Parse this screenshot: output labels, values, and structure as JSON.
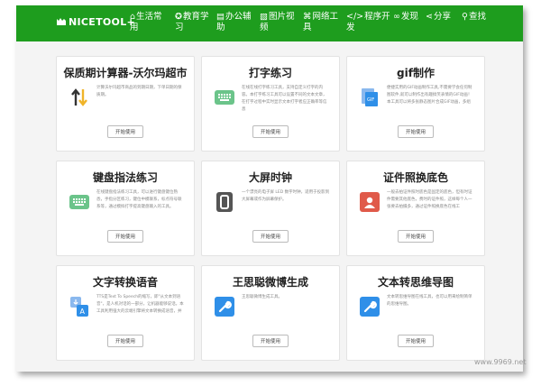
{
  "nav": {
    "logo": "NICETOOL+",
    "items": [
      {
        "icon": "⌂",
        "label": "生活常用"
      },
      {
        "icon": "✪",
        "label": "教育学习"
      },
      {
        "icon": "▤",
        "label": "办公辅助"
      },
      {
        "icon": "▧",
        "label": "图片视频"
      },
      {
        "icon": "⌘",
        "label": "网络工具"
      },
      {
        "icon": "</>",
        "label": "程序开发"
      },
      {
        "icon": "∞",
        "label": "发现"
      },
      {
        "icon": "⋖",
        "label": "分享"
      },
      {
        "icon": "⚲",
        "label": "查找"
      }
    ]
  },
  "colors": {
    "nav_bg": "#1e9d1e",
    "accent": "#2f8fe8",
    "keyboard_green": "#6bc48a",
    "profile_red": "#e05a4a"
  },
  "cards": [
    {
      "title": "保质期计算器-沃尔玛超市",
      "icon": "up-down-arrows-icon",
      "desc": "计算沃尔玛超市商品的到期日期，下单日期的保质期。",
      "button": "开始使用"
    },
    {
      "title": "打字练习",
      "icon": "keyboard-icon",
      "desc": "在线在线打字练习工具，支持自定义打字的内容。本打字练习工具可以设置不同的文本文章，在打字过程中实时显示文本打字者应正确率等信息",
      "button": "开始使用"
    },
    {
      "title": "gif制作",
      "icon": "gif-icon",
      "desc": "便捷实用的GIF动画制作工具,不需要学会任何制图软件,就可以制作出有趣搞笑表情的GIF动画！本工具可以将多张静态图片合成GIF动画，多组",
      "button": "开始使用"
    },
    {
      "title": "键盘指法练习",
      "icon": "keyboard-icon",
      "desc": "在线键盘指法练习工具，可以进行键盘键位熟悉，手指分区练习，键位中模联系，标点符号联系等，通过模拟打字提高键盘输入的工具。",
      "button": "开始使用"
    },
    {
      "title": "大屏时钟",
      "icon": "digital-zero-icon",
      "desc": "一个漂亮的电子屏 LED 数字时钟，适用于投影到大屏幕或作为屏幕保护。",
      "button": "开始使用"
    },
    {
      "title": "证件照换底色",
      "icon": "profile-photo-icon",
      "desc": "一般去拍证件照时底色是固定的底色，但有时证件需要其他底色，费时的证件照，这样每个人一张要去拍摄多，通过证件照换底色在线工",
      "button": "开始使用"
    },
    {
      "title": "文字转换语音",
      "icon": "text-to-speech-icon",
      "desc": "TTS是Text To Speech的缩写，即\"从文本到语音\"，是人机对话的一部分，让机器能够说话。本工具利用强大的云端引擎将文本转换成语音，并",
      "button": "开始使用"
    },
    {
      "title": "王思聪微博生成",
      "icon": "wrench-icon",
      "desc": "王思聪微博生成工具。",
      "button": "开始使用"
    },
    {
      "title": "文本转思维导图",
      "icon": "wrench-icon",
      "desc": "文本转思维导图在线工具，也可以用来绘制简单的思维导图。",
      "button": "开始使用"
    }
  ],
  "watermark": "www.9969.net"
}
